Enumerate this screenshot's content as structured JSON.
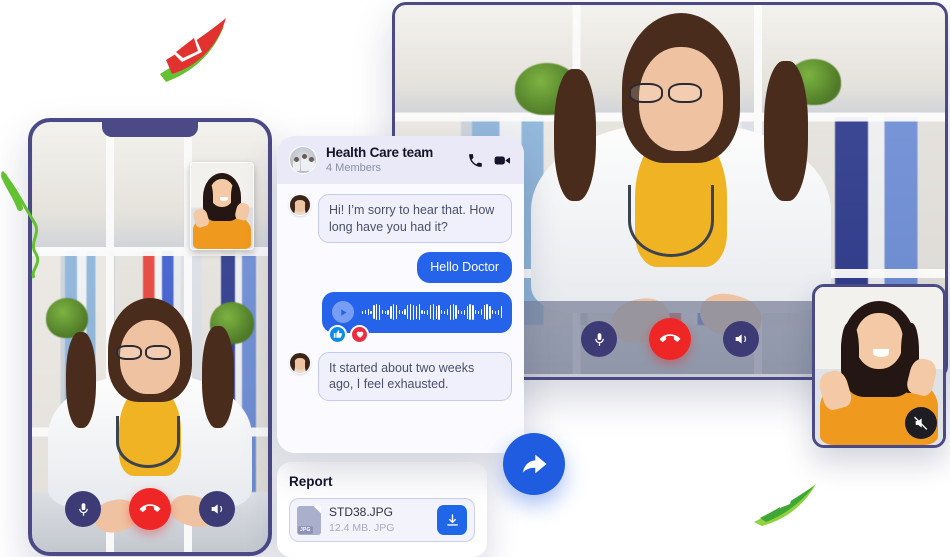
{
  "chat": {
    "title": "Health Care team",
    "members": "4 Members",
    "header_icons": [
      {
        "name": "phone-call-icon",
        "label": "Call"
      },
      {
        "name": "video-camera-icon",
        "label": "Video"
      }
    ],
    "messages": [
      {
        "id": "m1",
        "direction": "incoming",
        "text": "Hi! I’m sorry to hear that. How long have you had it?",
        "avatar": "doctor-avatar"
      },
      {
        "id": "m2",
        "direction": "outgoing",
        "text": "Hello  Doctor"
      },
      {
        "id": "m3",
        "direction": "outgoing",
        "type": "voice",
        "play_label": "Play voice message",
        "reactions": [
          {
            "name": "thumbs-up-reaction",
            "glyph": "👍"
          },
          {
            "name": "heart-reaction",
            "glyph": "❤"
          }
        ]
      },
      {
        "id": "m4",
        "direction": "incoming",
        "text": "It started about two weeks ago, I feel exhausted.",
        "avatar": "patient-avatar"
      }
    ]
  },
  "report": {
    "title": "Report",
    "file_name": "STD38.JPG",
    "file_meta": "12.4 MB. JPG",
    "file_ext_badge": "JPG",
    "download_label": "Download"
  },
  "main_call": {
    "controls": [
      {
        "name": "microphone-button",
        "label": "Mute microphone",
        "style": "navy"
      },
      {
        "name": "end-call-button",
        "label": "End call",
        "style": "red"
      },
      {
        "name": "speaker-button",
        "label": "Speaker",
        "style": "navy"
      }
    ]
  },
  "phone_call": {
    "controls": [
      {
        "name": "microphone-button",
        "label": "Mute microphone",
        "style": "navy"
      },
      {
        "name": "end-call-button",
        "label": "End call",
        "style": "red"
      },
      {
        "name": "speaker-button",
        "label": "Speaker",
        "style": "navy"
      }
    ],
    "self_view_label": "Self view"
  },
  "pip": {
    "label": "Participant video",
    "muted_badge": "speaker-muted-icon"
  },
  "share": {
    "label": "Share"
  },
  "decorations": [
    {
      "name": "app-logo-decoration",
      "label": "Red and green logo mark"
    },
    {
      "name": "paper-plane-decoration",
      "label": "Green paper plane"
    },
    {
      "name": "squiggle-decoration",
      "label": "Green squiggle line"
    }
  ],
  "colors": {
    "accent_blue": "#2563eb",
    "share_blue": "#1f5ce0",
    "end_call_red": "#ef2626",
    "control_navy": "#3c3b76",
    "frame_purple": "#4b4a86",
    "chat_header_lilac": "#e9e9f7",
    "bubble_in_bg": "#eff0fb",
    "bubble_in_border": "#c3cbf0",
    "orange_shirt": "#ef9a1e",
    "reaction_like": "#0a8bf0",
    "reaction_love": "#ef2d3f",
    "deco_green": "#63c132",
    "deco_red": "#e2322f"
  }
}
